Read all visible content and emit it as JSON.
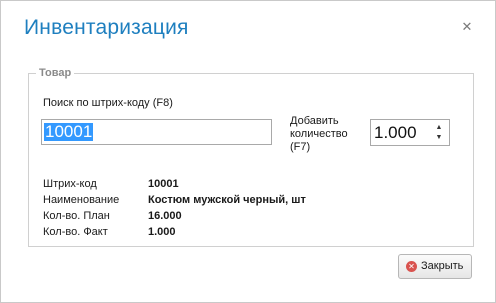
{
  "dialog": {
    "title": "Инвентаризация",
    "close_icon": "close-icon"
  },
  "group": {
    "legend": "Товар"
  },
  "search": {
    "label": "Поиск по штрих-коду (F8)",
    "value": "10001"
  },
  "quantity": {
    "label": "Добавить количество (F7)",
    "value": "1.000"
  },
  "info": {
    "barcode_label": "Штрих-код",
    "barcode_value": "10001",
    "name_label": "Наименование",
    "name_value": "Костюм мужской черный, шт",
    "plan_label": "Кол-во. План",
    "plan_value": "16.000",
    "fact_label": "Кол-во. Факт",
    "fact_value": "1.000"
  },
  "footer": {
    "close_button": "Закрыть",
    "close_button_icon": "cancel-icon"
  }
}
